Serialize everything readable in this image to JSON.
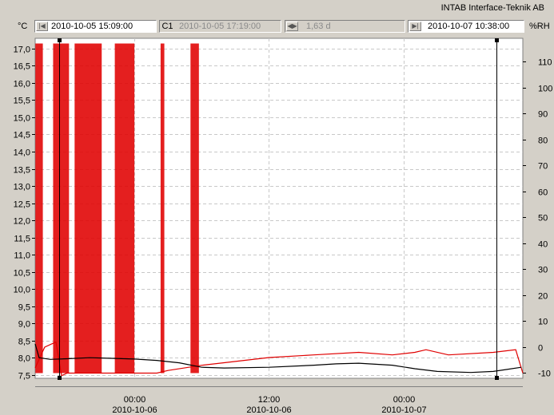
{
  "header": {
    "company": "INTAB Interface-Teknik AB"
  },
  "toolbar": {
    "left_unit": "°C",
    "right_unit": "%RH",
    "start_time": "2010-10-05 15:09:00",
    "cursor_label": "C1",
    "cursor_time": "2010-10-05 17:19:00",
    "span": "1,63 d",
    "end_time": "2010-10-07 10:38:00",
    "icons": [
      "skip-start-icon",
      "cursor-icon",
      "span-arrows-icon",
      "skip-end-icon"
    ]
  },
  "chart_data": {
    "type": "line",
    "x_range": [
      "2010-10-05 15:09:00",
      "2010-10-07 10:38:00"
    ],
    "y_left": {
      "unit": "°C",
      "range": [
        7.4,
        17.3
      ],
      "ticks": [
        "17,0",
        "16,5",
        "16,0",
        "15,5",
        "15,0",
        "14,5",
        "14,0",
        "13,5",
        "13,0",
        "12,5",
        "12,0",
        "11,5",
        "11,0",
        "10,5",
        "10,0",
        "9,5",
        "9,0",
        "8,5",
        "8,0",
        "7,5"
      ]
    },
    "y_right": {
      "unit": "%RH",
      "range": [
        -12,
        119
      ],
      "ticks": [
        "110",
        "100",
        "90",
        "80",
        "70",
        "60",
        "50",
        "40",
        "30",
        "20",
        "10",
        "0",
        "-10"
      ]
    },
    "x_ticks": [
      {
        "time": "00:00",
        "date": "2010-10-06",
        "t": "2010-10-06 00:00"
      },
      {
        "time": "12:00",
        "date": "2010-10-06",
        "t": "2010-10-06 12:00"
      },
      {
        "time": "00:00",
        "date": "2010-10-07",
        "t": "2010-10-07 00:00"
      }
    ],
    "grid": true,
    "cursors": [
      "2010-10-05 15:09:00",
      "2010-10-07 10:38:00"
    ],
    "series": [
      {
        "axis": "left",
        "color": "#000000",
        "points": [
          [
            "2010-10-05 15:09",
            8.4
          ],
          [
            "2010-10-05 15:30",
            8.0
          ],
          [
            "2010-10-05 16:30",
            7.95
          ],
          [
            "2010-10-05 18:00",
            7.97
          ],
          [
            "2010-10-05 20:00",
            8.0
          ],
          [
            "2010-10-05 22:00",
            7.98
          ],
          [
            "2010-10-06 00:00",
            7.96
          ],
          [
            "2010-10-06 02:00",
            7.92
          ],
          [
            "2010-10-06 04:00",
            7.85
          ],
          [
            "2010-10-06 06:00",
            7.72
          ],
          [
            "2010-10-06 08:00",
            7.7
          ],
          [
            "2010-10-06 12:00",
            7.72
          ],
          [
            "2010-10-06 16:00",
            7.78
          ],
          [
            "2010-10-06 18:00",
            7.82
          ],
          [
            "2010-10-06 20:00",
            7.84
          ],
          [
            "2010-10-06 23:00",
            7.78
          ],
          [
            "2010-10-07 01:00",
            7.68
          ],
          [
            "2010-10-07 03:00",
            7.6
          ],
          [
            "2010-10-07 06:00",
            7.57
          ],
          [
            "2010-10-07 08:00",
            7.6
          ],
          [
            "2010-10-07 10:30",
            7.72
          ]
        ]
      },
      {
        "axis": "right",
        "color": "#e00000",
        "points": [
          [
            "2010-10-05 15:09",
            -8
          ],
          [
            "2010-10-05 16:00",
            0
          ],
          [
            "2010-10-05 17:00",
            2
          ],
          [
            "2010-10-05 17:30",
            -11
          ],
          [
            "2010-10-05 18:00",
            -10
          ],
          [
            "2010-10-05 22:00",
            -10
          ],
          [
            "2010-10-06 00:00",
            -10
          ],
          [
            "2010-10-06 02:00",
            -10
          ],
          [
            "2010-10-06 03:00",
            -9
          ],
          [
            "2010-10-06 06:00",
            -7
          ],
          [
            "2010-10-06 08:00",
            -6
          ],
          [
            "2010-10-06 12:00",
            -4
          ],
          [
            "2010-10-06 16:00",
            -3
          ],
          [
            "2010-10-06 20:00",
            -2
          ],
          [
            "2010-10-06 23:00",
            -3
          ],
          [
            "2010-10-07 01:00",
            -2
          ],
          [
            "2010-10-07 02:00",
            -1
          ],
          [
            "2010-10-07 04:00",
            -3
          ],
          [
            "2010-10-07 08:00",
            -2
          ],
          [
            "2010-10-07 10:00",
            -1
          ],
          [
            "2010-10-07 10:38",
            -10
          ]
        ],
        "spikes": [
          [
            "2010-10-05 15:10",
            "2010-10-05 15:50",
            117
          ],
          [
            "2010-10-05 16:45",
            "2010-10-05 18:10",
            117
          ],
          [
            "2010-10-05 18:40",
            "2010-10-05 21:05",
            117
          ],
          [
            "2010-10-05 22:15",
            "2010-10-06 00:00",
            117
          ],
          [
            "2010-10-06 02:20",
            "2010-10-06 02:40",
            117
          ],
          [
            "2010-10-06 05:00",
            "2010-10-06 05:45",
            117
          ]
        ]
      }
    ]
  }
}
